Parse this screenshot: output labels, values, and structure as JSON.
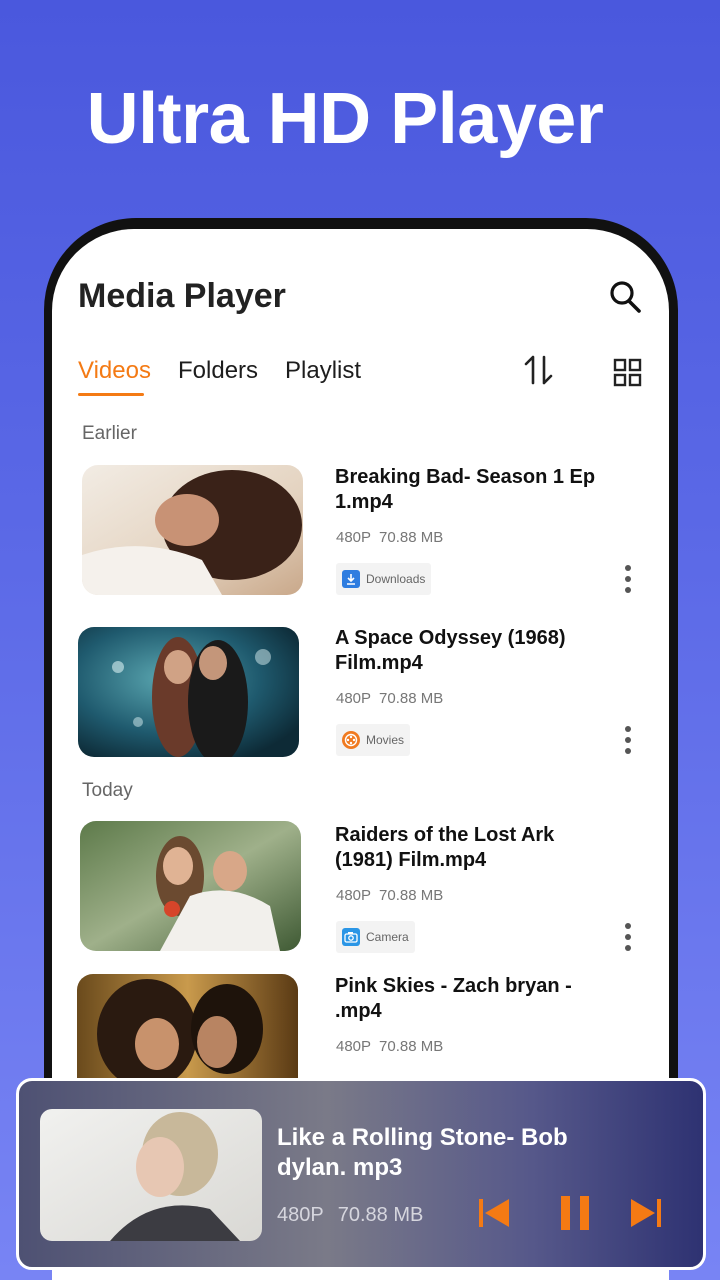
{
  "promo": {
    "headline": "Ultra HD Player"
  },
  "header": {
    "title": "Media Player"
  },
  "tabs": [
    {
      "label": "Videos",
      "active": true
    },
    {
      "label": "Folders",
      "active": false
    },
    {
      "label": "Playlist",
      "active": false
    }
  ],
  "sections": {
    "earlier": "Earlier",
    "today": "Today"
  },
  "videos": [
    {
      "title": "Breaking Bad- Season 1 Ep 1.mp4",
      "resolution": "480P",
      "size": "70.88 MB",
      "folder": "Downloads",
      "folder_icon": "download-icon",
      "folder_color": "#2f7de0"
    },
    {
      "title": "A Space Odyssey (1968) Film.mp4",
      "resolution": "480P",
      "size": "70.88 MB",
      "folder": "Movies",
      "folder_icon": "film-reel-icon",
      "folder_color": "#f07a20"
    },
    {
      "title": "Raiders of the Lost Ark (1981) Film.mp4",
      "resolution": "480P",
      "size": "70.88 MB",
      "folder": "Camera",
      "folder_icon": "camera-icon",
      "folder_color": "#2b96e6"
    },
    {
      "title": "Pink Skies - Zach bryan - .mp4",
      "resolution": "480P",
      "size": "70.88 MB"
    }
  ],
  "now_playing": {
    "title": "Like a Rolling Stone- Bob dylan. mp3",
    "resolution": "480P",
    "size": "70.88 MB"
  },
  "colors": {
    "accent": "#f47a14",
    "background": "#4a58dd"
  }
}
